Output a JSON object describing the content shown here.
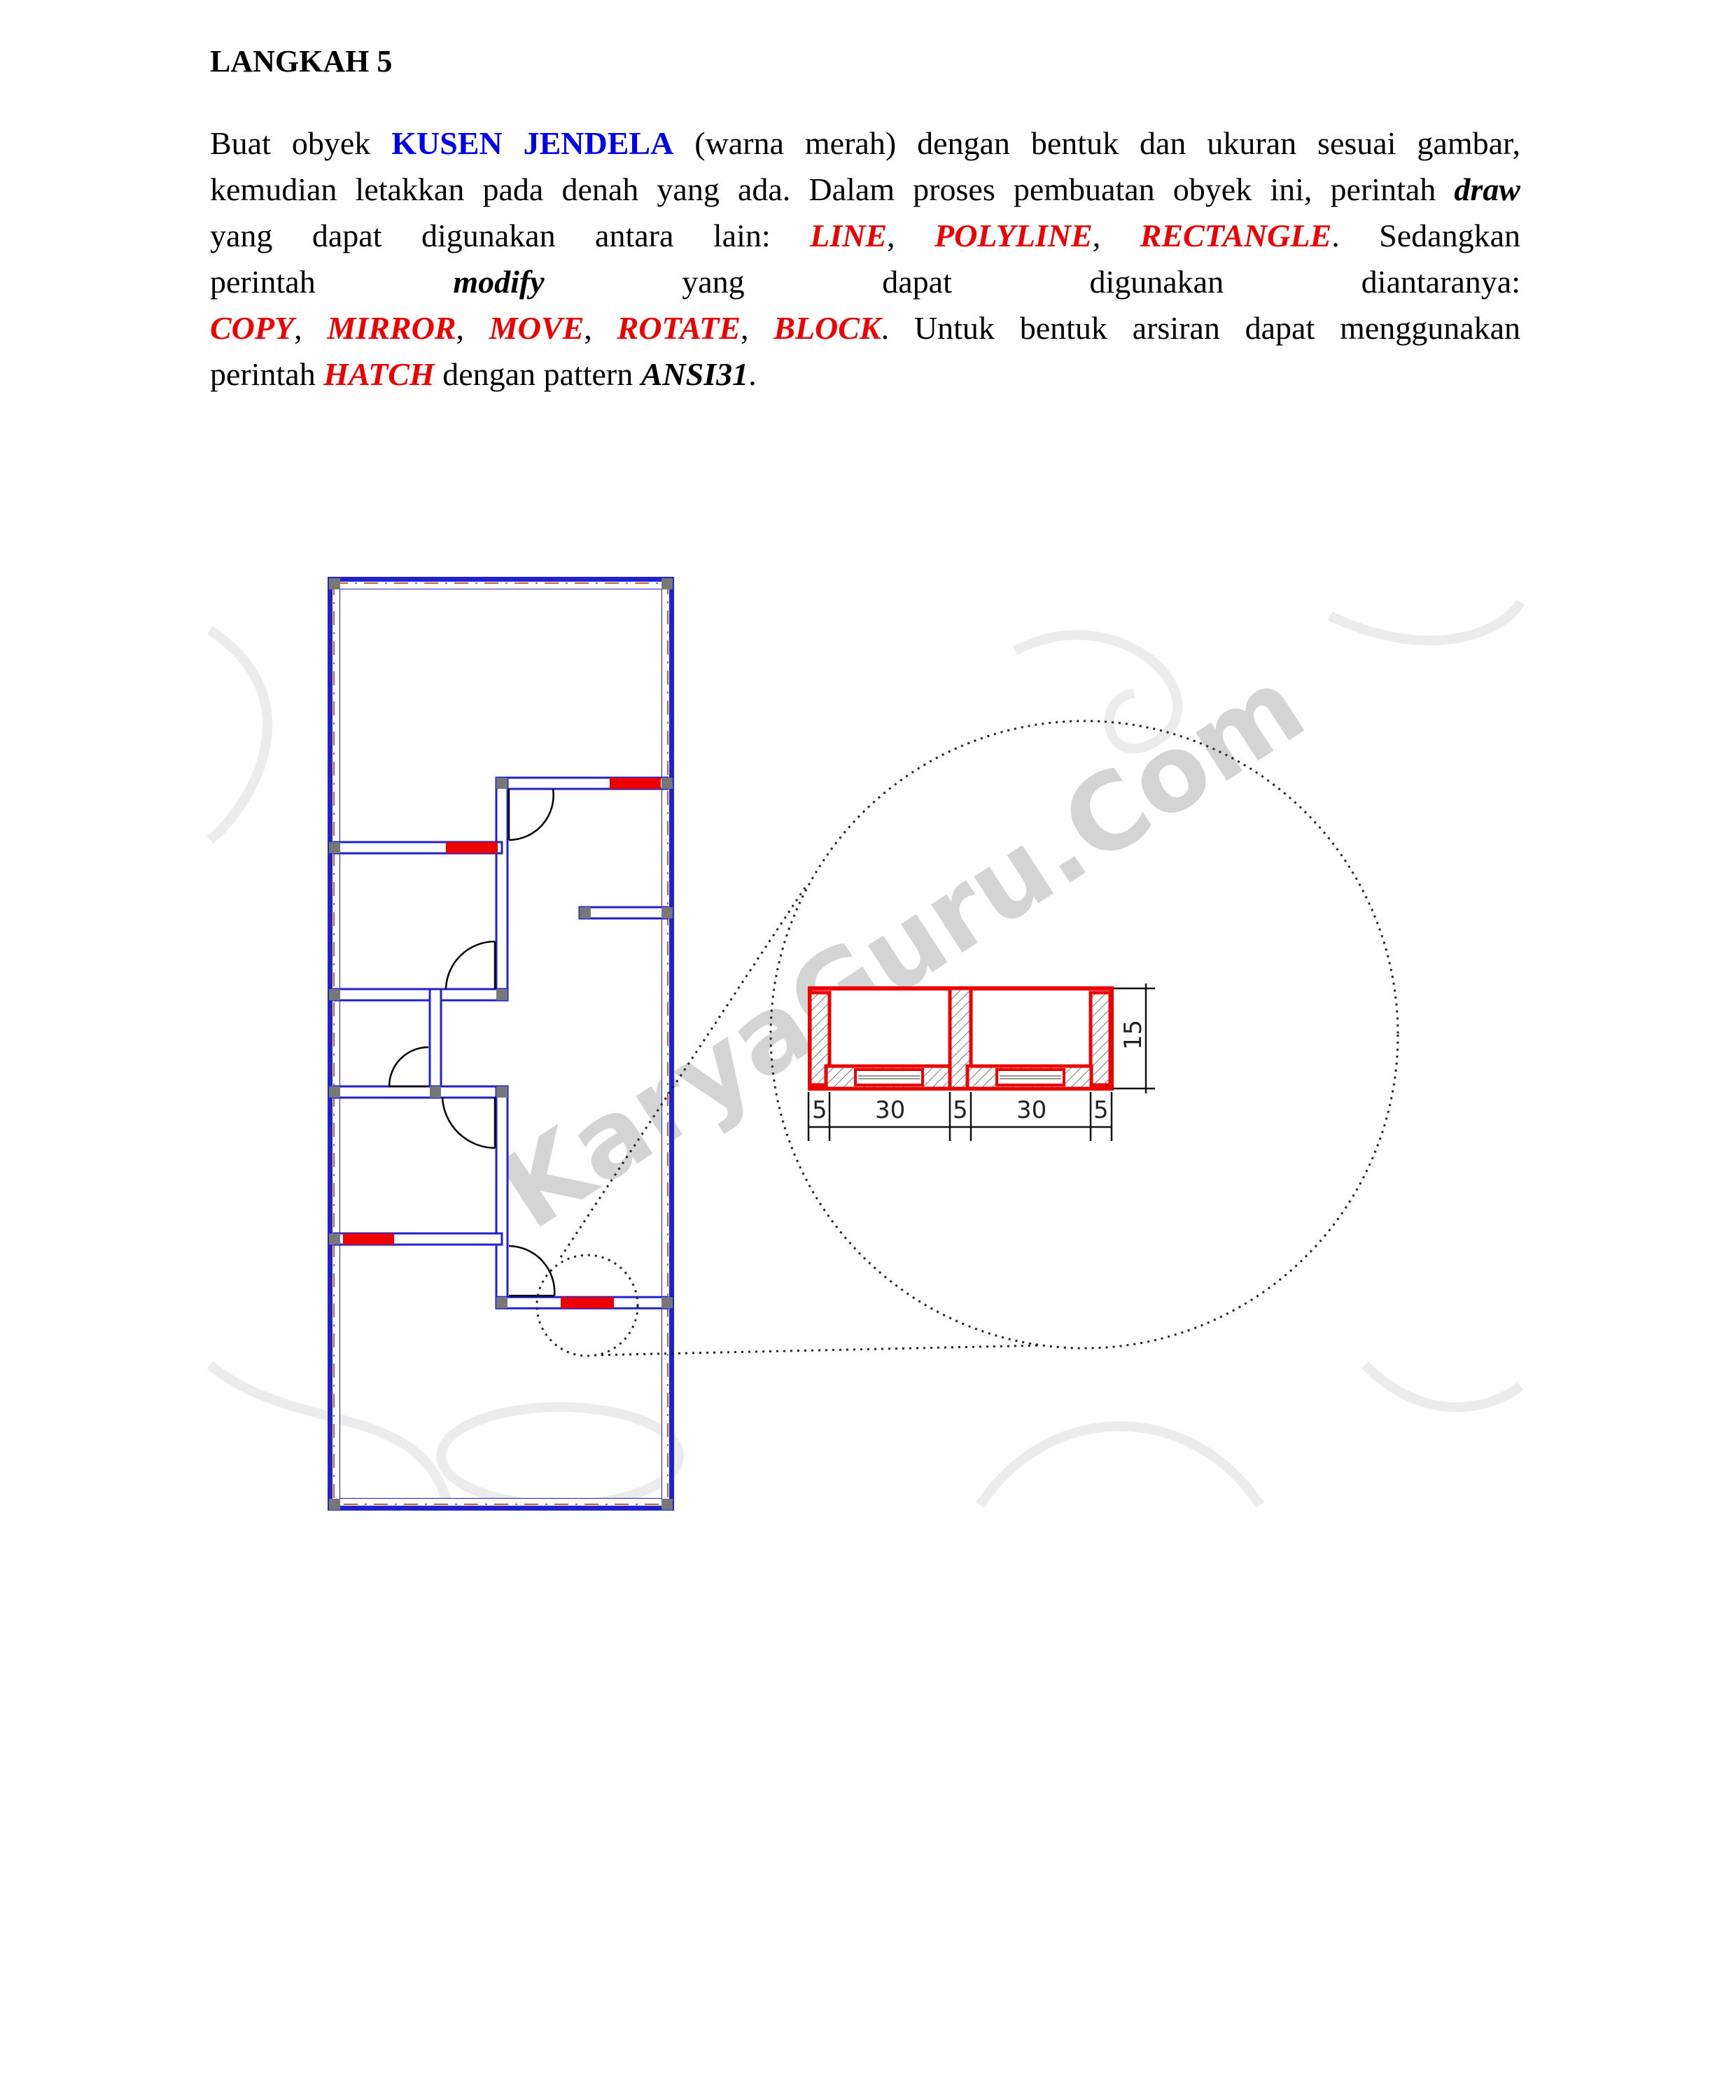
{
  "heading": "LANGKAH 5",
  "paragraph": {
    "l1": {
      "a": "Buat obyek ",
      "b": "KUSEN JENDELA",
      "c": " (warna merah) dengan bentuk dan ukuran sesuai gambar,"
    },
    "l2": {
      "a": "kemudian letakkan pada denah yang ada. Dalam proses pembuatan obyek ini, perintah ",
      "b": "draw"
    },
    "l3": {
      "a": "yang dapat digunakan antara lain: ",
      "b": "LINE",
      "c": ", ",
      "d": "POLYLINE",
      "e": ", ",
      "f": "RECTANGLE",
      "g": ". Sedangkan"
    },
    "l4": {
      "a": "perintah ",
      "b": "modify",
      "c": " yang dapat digunakan diantaranya:"
    },
    "l5": {
      "a": "COPY",
      "b": ", ",
      "c": "MIRROR",
      "d": ", ",
      "e": "MOVE",
      "f": ", ",
      "g": "ROTATE",
      "h": ", ",
      "i": "BLOCK",
      "j": ". Untuk bentuk arsiran dapat menggunakan"
    },
    "l6": {
      "a": "perintah ",
      "b": "HATCH",
      "c": " dengan pattern ",
      "d": "ANSI31",
      "e": "."
    }
  },
  "figure": {
    "watermark": "KaryaGuru.Com",
    "dimensions": {
      "post_left": "5",
      "pane_left": "30",
      "post_mid": "5",
      "pane_right": "30",
      "post_right": "5",
      "height": "15"
    },
    "colors": {
      "window_frame": "#ee0000",
      "wall": "#2222cc",
      "highlight": "#0000ee",
      "command": "#ee0000"
    }
  }
}
